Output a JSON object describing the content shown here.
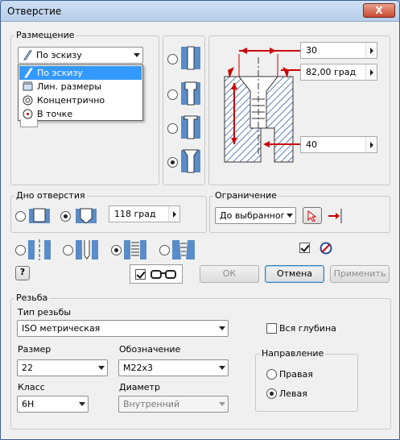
{
  "window": {
    "title": "Отверстие",
    "close_glyph": "X"
  },
  "placement": {
    "group_label": "Размещение",
    "selected": "По эскизу",
    "options": [
      {
        "label": "По эскизу",
        "icon": "sketch-icon",
        "selected": true
      },
      {
        "label": "Лин. размеры",
        "icon": "linear-dims-icon",
        "selected": false
      },
      {
        "label": "Концентрично",
        "icon": "concentric-icon",
        "selected": false
      },
      {
        "label": "В точке",
        "icon": "point-icon",
        "selected": false
      }
    ]
  },
  "hole_type": {
    "options": [
      "simple-hole",
      "counterbore",
      "spotface",
      "countersink"
    ],
    "selected_index": 3
  },
  "dimensions": {
    "top_value": "30",
    "angle_value": "82,00 град",
    "depth_value": "40"
  },
  "bottom": {
    "group_label": "Дно отверстия",
    "options": [
      "flat",
      "angle"
    ],
    "selected_index": 1,
    "angle_value": "118 град"
  },
  "termination": {
    "group_label": "Ограничение",
    "value": "До выбранного",
    "select_icon": "arrow-select-icon",
    "flip_icon": "flip-icon"
  },
  "thread_types": {
    "options": [
      "simple",
      "clearance",
      "tapped",
      "taper-tapped"
    ],
    "selected_index": 2
  },
  "misc": {
    "chk1_checked": true,
    "chk2_checked": true,
    "help_icon": "help-icon",
    "preview_icon": "glasses-icon",
    "no_icon": "prohibited-icon"
  },
  "buttons": {
    "ok": "ОК",
    "cancel": "Отмена",
    "apply": "Применить"
  },
  "thread": {
    "group_label": "Резьба",
    "type_label": "Тип резьбы",
    "type_value": "ISO метрическая",
    "full_depth_label": "Вся глубина",
    "full_depth_checked": false,
    "size_label": "Размер",
    "size_value": "22",
    "designation_label": "Обозначение",
    "designation_value": "M22x3",
    "class_label": "Класс",
    "class_value": "6H",
    "diameter_label": "Диаметр",
    "diameter_value": "Внутренний",
    "direction_label": "Направление",
    "direction_right": "Правая",
    "direction_left": "Левая",
    "direction_selected": "Левая"
  }
}
